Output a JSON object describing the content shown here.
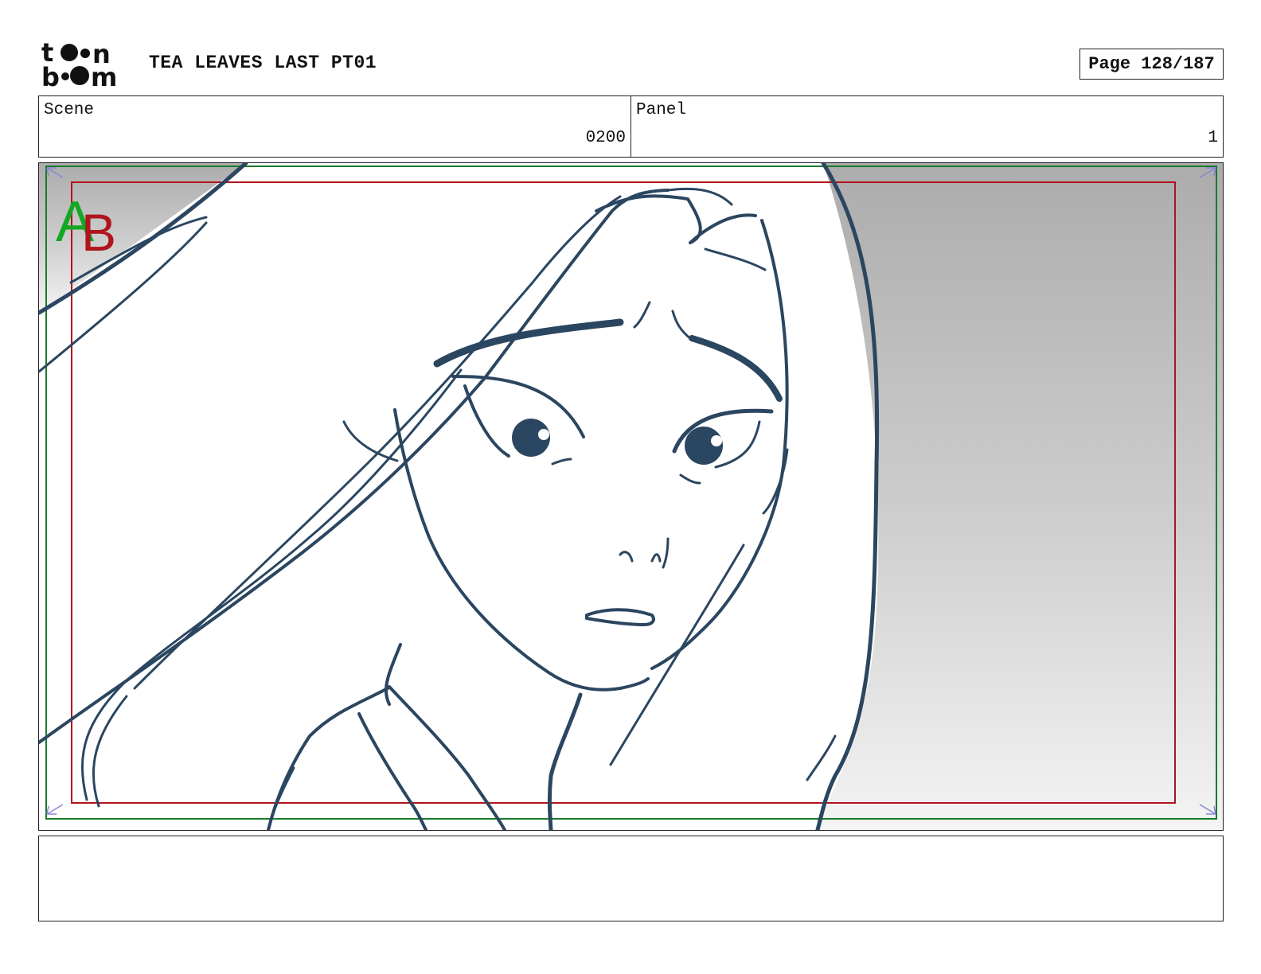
{
  "header": {
    "logo_text": "toon boom",
    "title": "TEA LEAVES LAST PT01",
    "page_label": "Page 128/187"
  },
  "info": {
    "scene_label": "Scene",
    "scene_value": "0200",
    "panel_label": "Panel",
    "panel_value": "1"
  },
  "panel": {
    "safe_area_marker_a": "A",
    "safe_area_marker_b": "B",
    "line_color": "#2b4660",
    "title_safe_color": "#b0141c",
    "action_safe_color": "#1a7a2a",
    "marker_a_color": "#13a824",
    "marker_b_color": "#b0141c"
  },
  "notes": {
    "text": ""
  }
}
